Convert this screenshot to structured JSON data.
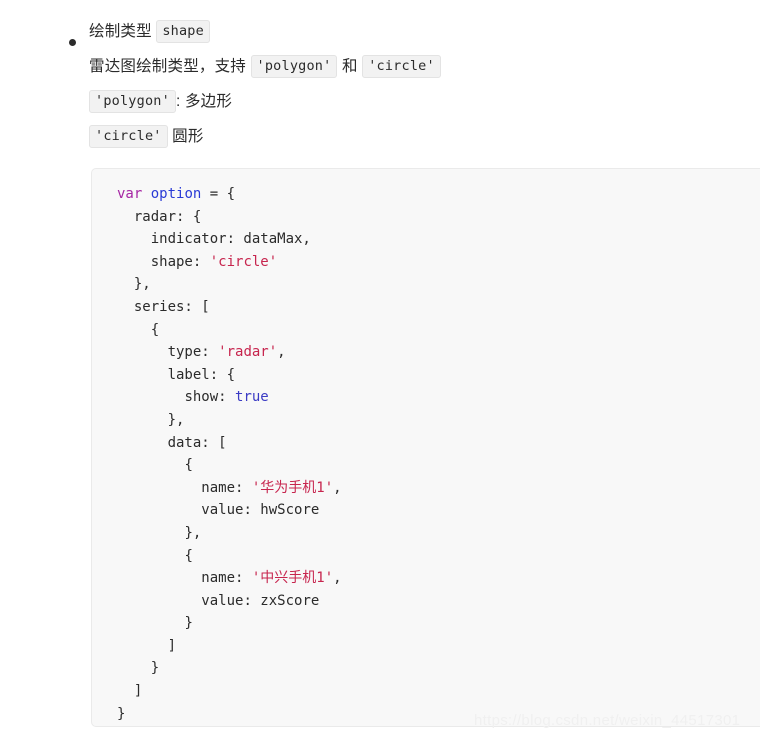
{
  "page": {
    "background_color": "#ffffff",
    "watermark": "https://blog.csdn.net/weixin_44517301"
  },
  "doc": {
    "bullet": {
      "marker": "bullet-dot",
      "lines": [
        {
          "id": "line-title",
          "segments": [
            {
              "type": "text",
              "text": "绘制类型 "
            },
            {
              "type": "code",
              "text": "shape"
            }
          ]
        },
        {
          "id": "line-description",
          "segments": [
            {
              "type": "text",
              "text": "雷达图绘制类型，支持 "
            },
            {
              "type": "code",
              "text": "'polygon'"
            },
            {
              "type": "text",
              "text": " 和 "
            },
            {
              "type": "code",
              "text": "'circle'"
            }
          ]
        },
        {
          "id": "line-polygon",
          "segments": [
            {
              "type": "code",
              "text": "'polygon'"
            },
            {
              "type": "text",
              "text": ": 多边形"
            }
          ]
        },
        {
          "id": "line-circle",
          "segments": [
            {
              "type": "code",
              "text": "'circle'"
            },
            {
              "type": "text",
              "text": " 圆形"
            }
          ]
        }
      ],
      "line_texts": {
        "title_text": "绘制类型 ",
        "title_code": "shape",
        "desc_text_1": "雷达图绘制类型，支持 ",
        "desc_code_1": "'polygon'",
        "desc_text_2": " 和 ",
        "desc_code_2": "'circle'",
        "polygon_code": "'polygon'",
        "polygon_text": ": 多边形",
        "circle_code": "'circle'",
        "circle_text": " 圆形"
      }
    }
  },
  "code_block": {
    "language": "javascript",
    "background_color": "#f8f8f8",
    "token_colors": {
      "keyword": "#a626a4",
      "variable": "#2a3bd6",
      "string": "#c7254e",
      "boolean": "#3b3bc4",
      "plain": "#2b2b2b"
    },
    "lines": [
      {
        "n": 1,
        "indent": 0,
        "tokens": [
          {
            "t": "kw",
            "v": "var"
          },
          {
            "t": "plain",
            "v": " "
          },
          {
            "t": "var",
            "v": "option"
          },
          {
            "t": "plain",
            "v": " = {"
          }
        ]
      },
      {
        "n": 2,
        "indent": 1,
        "tokens": [
          {
            "t": "plain",
            "v": "radar: {"
          }
        ]
      },
      {
        "n": 3,
        "indent": 2,
        "tokens": [
          {
            "t": "plain",
            "v": "indicator: dataMax,"
          }
        ]
      },
      {
        "n": 4,
        "indent": 2,
        "tokens": [
          {
            "t": "plain",
            "v": "shape: "
          },
          {
            "t": "str",
            "v": "'circle'"
          }
        ]
      },
      {
        "n": 5,
        "indent": 1,
        "tokens": [
          {
            "t": "plain",
            "v": "},"
          }
        ]
      },
      {
        "n": 6,
        "indent": 1,
        "tokens": [
          {
            "t": "plain",
            "v": "series: ["
          }
        ]
      },
      {
        "n": 7,
        "indent": 2,
        "tokens": [
          {
            "t": "plain",
            "v": "{"
          }
        ]
      },
      {
        "n": 8,
        "indent": 3,
        "tokens": [
          {
            "t": "plain",
            "v": "type: "
          },
          {
            "t": "str",
            "v": "'radar'"
          },
          {
            "t": "plain",
            "v": ","
          }
        ]
      },
      {
        "n": 9,
        "indent": 3,
        "tokens": [
          {
            "t": "plain",
            "v": "label: {"
          }
        ]
      },
      {
        "n": 10,
        "indent": 4,
        "tokens": [
          {
            "t": "plain",
            "v": "show: "
          },
          {
            "t": "bool",
            "v": "true"
          }
        ]
      },
      {
        "n": 11,
        "indent": 3,
        "tokens": [
          {
            "t": "plain",
            "v": "},"
          }
        ]
      },
      {
        "n": 12,
        "indent": 3,
        "tokens": [
          {
            "t": "plain",
            "v": "data: ["
          }
        ]
      },
      {
        "n": 13,
        "indent": 4,
        "tokens": [
          {
            "t": "plain",
            "v": "{"
          }
        ]
      },
      {
        "n": 14,
        "indent": 5,
        "tokens": [
          {
            "t": "plain",
            "v": "name: "
          },
          {
            "t": "str",
            "v": "'华为手机1'"
          },
          {
            "t": "plain",
            "v": ","
          }
        ]
      },
      {
        "n": 15,
        "indent": 5,
        "tokens": [
          {
            "t": "plain",
            "v": "value: hwScore"
          }
        ]
      },
      {
        "n": 16,
        "indent": 4,
        "tokens": [
          {
            "t": "plain",
            "v": "},"
          }
        ]
      },
      {
        "n": 17,
        "indent": 4,
        "tokens": [
          {
            "t": "plain",
            "v": "{"
          }
        ]
      },
      {
        "n": 18,
        "indent": 5,
        "tokens": [
          {
            "t": "plain",
            "v": "name: "
          },
          {
            "t": "str",
            "v": "'中兴手机1'"
          },
          {
            "t": "plain",
            "v": ","
          }
        ]
      },
      {
        "n": 19,
        "indent": 5,
        "tokens": [
          {
            "t": "plain",
            "v": "value: zxScore"
          }
        ]
      },
      {
        "n": 20,
        "indent": 4,
        "tokens": [
          {
            "t": "plain",
            "v": "}"
          }
        ]
      },
      {
        "n": 21,
        "indent": 3,
        "tokens": [
          {
            "t": "plain",
            "v": "]"
          }
        ]
      },
      {
        "n": 22,
        "indent": 2,
        "tokens": [
          {
            "t": "plain",
            "v": "}"
          }
        ]
      },
      {
        "n": 23,
        "indent": 1,
        "tokens": [
          {
            "t": "plain",
            "v": "]"
          }
        ]
      },
      {
        "n": 24,
        "indent": 0,
        "tokens": [
          {
            "t": "plain",
            "v": "}"
          }
        ]
      }
    ]
  }
}
